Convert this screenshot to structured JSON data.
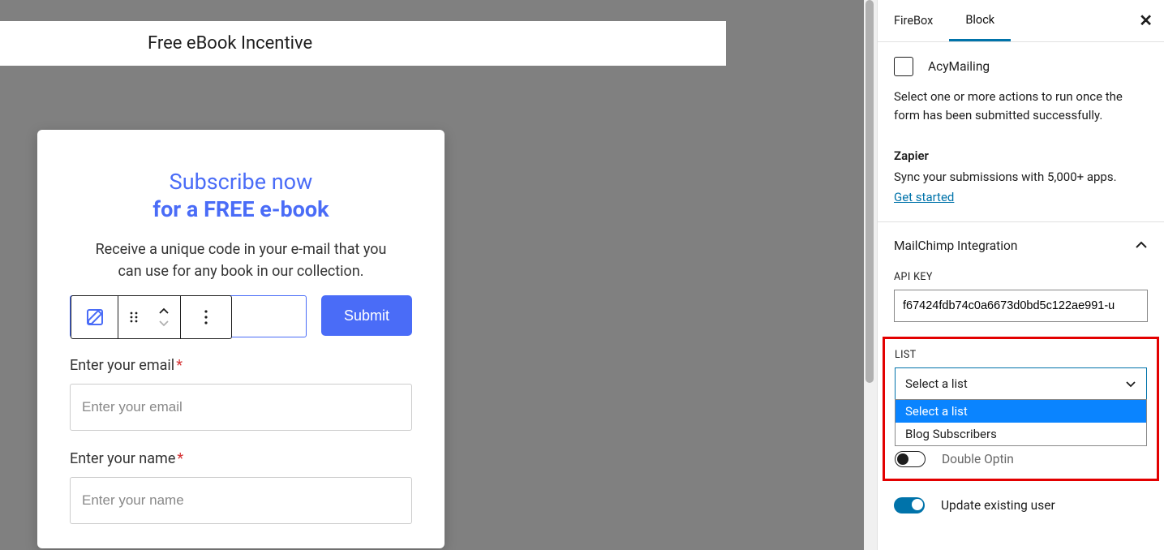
{
  "title": "Free eBook Incentive",
  "modal": {
    "heading1": "Subscribe now",
    "heading2": "for a FREE e-book",
    "desc_line1": "Receive a unique code in your e-mail that you",
    "desc_line2": "can use for any book in our collection.",
    "email_value": "",
    "email_placeholder": "Enter your email",
    "submit_label": "Submit",
    "email_label": "Enter your email",
    "name_label": "Enter your name",
    "name_placeholder": "Enter your name"
  },
  "sidebar": {
    "tabs": {
      "firebox": "FireBox",
      "block": "Block"
    },
    "acy_label": "AcyMailing",
    "acy_help": "Select one or more actions to run once the form has been submitted successfully.",
    "zapier_title": "Zapier",
    "zapier_desc": "Sync your submissions with 5,000+ apps.",
    "zapier_link": "Get started",
    "accordion_title": "MailChimp Integration",
    "api_label": "API KEY",
    "api_value": "f67424fdb74c0a6673d0bd5c122ae991-u",
    "list_label": "LIST",
    "list_selected": "Select a list",
    "list_options": [
      "Select a list",
      "Blog Subscribers"
    ],
    "double_optin_label": "Double Optin",
    "update_label": "Update existing user"
  }
}
